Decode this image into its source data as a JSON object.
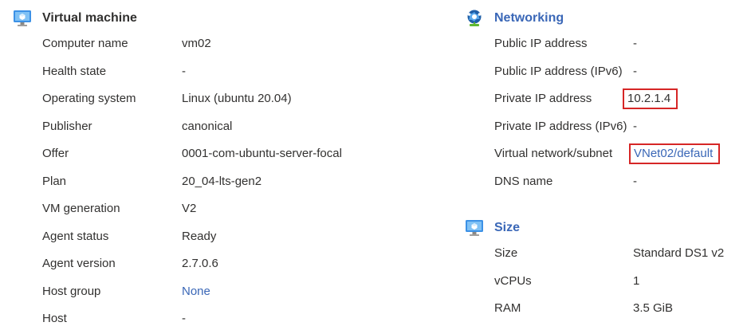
{
  "colors": {
    "accent": "#3a67b7",
    "highlight_border": "#d62626",
    "text": "#323130"
  },
  "vm": {
    "icon": "monitor-icon",
    "title": "Virtual machine",
    "rows": [
      {
        "label": "Computer name",
        "value": "vm02"
      },
      {
        "label": "Health state",
        "value": "-"
      },
      {
        "label": "Operating system",
        "value": "Linux (ubuntu 20.04)"
      },
      {
        "label": "Publisher",
        "value": "canonical"
      },
      {
        "label": "Offer",
        "value": "0001-com-ubuntu-server-focal"
      },
      {
        "label": "Plan",
        "value": "20_04-lts-gen2"
      },
      {
        "label": "VM generation",
        "value": "V2"
      },
      {
        "label": "Agent status",
        "value": "Ready"
      },
      {
        "label": "Agent version",
        "value": "2.7.0.6"
      },
      {
        "label": "Host group",
        "value": "None"
      },
      {
        "label": "Host",
        "value": "-"
      }
    ]
  },
  "networking": {
    "icon": "network-globe-icon",
    "title": "Networking",
    "rows": [
      {
        "label": "Public IP address",
        "value": "-"
      },
      {
        "label": "Public IP address (IPv6)",
        "value": "-"
      },
      {
        "label": "Private IP address",
        "value": "10.2.1.4"
      },
      {
        "label": "Private IP address (IPv6)",
        "value": "-"
      },
      {
        "label": "Virtual network/subnet",
        "value": "VNet02/default"
      },
      {
        "label": "DNS name",
        "value": "-"
      }
    ]
  },
  "size": {
    "icon": "monitor-icon",
    "title": "Size",
    "rows": [
      {
        "label": "Size",
        "value": "Standard DS1 v2"
      },
      {
        "label": "vCPUs",
        "value": "1"
      },
      {
        "label": "RAM",
        "value": "3.5 GiB"
      }
    ]
  }
}
